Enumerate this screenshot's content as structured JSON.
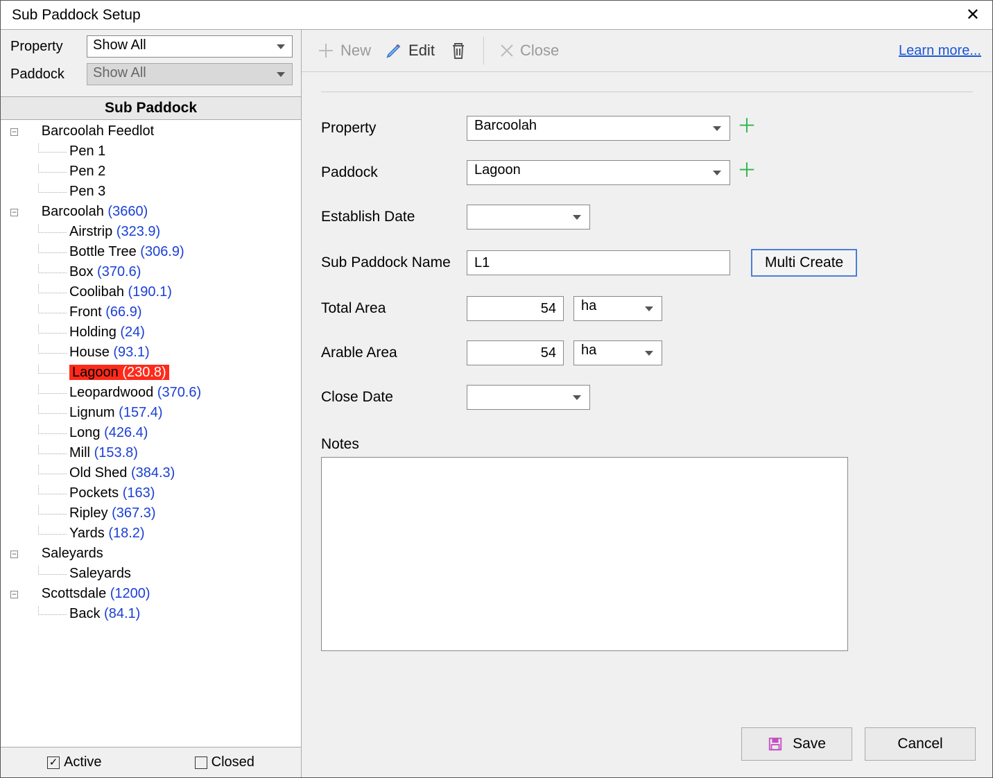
{
  "title": "Sub Paddock Setup",
  "filters": {
    "property_label": "Property",
    "property_value": "Show All",
    "paddock_label": "Paddock",
    "paddock_value": "Show All"
  },
  "tree_header": "Sub Paddock",
  "tree": [
    {
      "type": "group",
      "label": "Barcoolah Feedlot",
      "expanded": true
    },
    {
      "type": "leaf",
      "label": "Pen 1"
    },
    {
      "type": "leaf",
      "label": "Pen 2"
    },
    {
      "type": "leaf",
      "label": "Pen 3"
    },
    {
      "type": "group",
      "label": "Barcoolah",
      "area": "(3660)",
      "expanded": true
    },
    {
      "type": "leaf",
      "label": "Airstrip",
      "area": "(323.9)"
    },
    {
      "type": "leaf",
      "label": "Bottle Tree",
      "area": "(306.9)"
    },
    {
      "type": "leaf",
      "label": "Box",
      "area": "(370.6)"
    },
    {
      "type": "leaf",
      "label": "Coolibah",
      "area": "(190.1)"
    },
    {
      "type": "leaf",
      "label": "Front",
      "area": "(66.9)"
    },
    {
      "type": "leaf",
      "label": "Holding",
      "area": "(24)"
    },
    {
      "type": "leaf",
      "label": "House",
      "area": "(93.1)"
    },
    {
      "type": "leaf",
      "label": "Lagoon",
      "area": "(230.8)",
      "selected": true
    },
    {
      "type": "leaf",
      "label": "Leopardwood",
      "area": "(370.6)"
    },
    {
      "type": "leaf",
      "label": "Lignum",
      "area": "(157.4)"
    },
    {
      "type": "leaf",
      "label": "Long",
      "area": "(426.4)"
    },
    {
      "type": "leaf",
      "label": "Mill",
      "area": "(153.8)"
    },
    {
      "type": "leaf",
      "label": "Old Shed",
      "area": "(384.3)"
    },
    {
      "type": "leaf",
      "label": "Pockets",
      "area": "(163)"
    },
    {
      "type": "leaf",
      "label": "Ripley",
      "area": "(367.3)"
    },
    {
      "type": "leaf",
      "label": "Yards",
      "area": "(18.2)"
    },
    {
      "type": "group",
      "label": "Saleyards",
      "expanded": true
    },
    {
      "type": "leaf",
      "label": "Saleyards"
    },
    {
      "type": "group",
      "label": "Scottsdale",
      "area": "(1200)",
      "expanded": true
    },
    {
      "type": "leaf",
      "label": "Back",
      "area": "(84.1)"
    }
  ],
  "checks": {
    "active": "Active",
    "closed": "Closed"
  },
  "toolbar": {
    "new": "New",
    "edit": "Edit",
    "close": "Close",
    "learn": "Learn more..."
  },
  "form": {
    "property_label": "Property",
    "property_value": "Barcoolah",
    "paddock_label": "Paddock",
    "paddock_value": "Lagoon",
    "establish_label": "Establish Date",
    "establish_value": "",
    "name_label": "Sub Paddock Name",
    "name_value": "L1",
    "multi_btn": "Multi Create",
    "total_label": "Total Area",
    "total_value": "54",
    "total_unit": "ha",
    "arable_label": "Arable Area",
    "arable_value": "54",
    "arable_unit": "ha",
    "closedate_label": "Close Date",
    "closedate_value": "",
    "notes_label": "Notes"
  },
  "actions": {
    "save": "Save",
    "cancel": "Cancel"
  }
}
